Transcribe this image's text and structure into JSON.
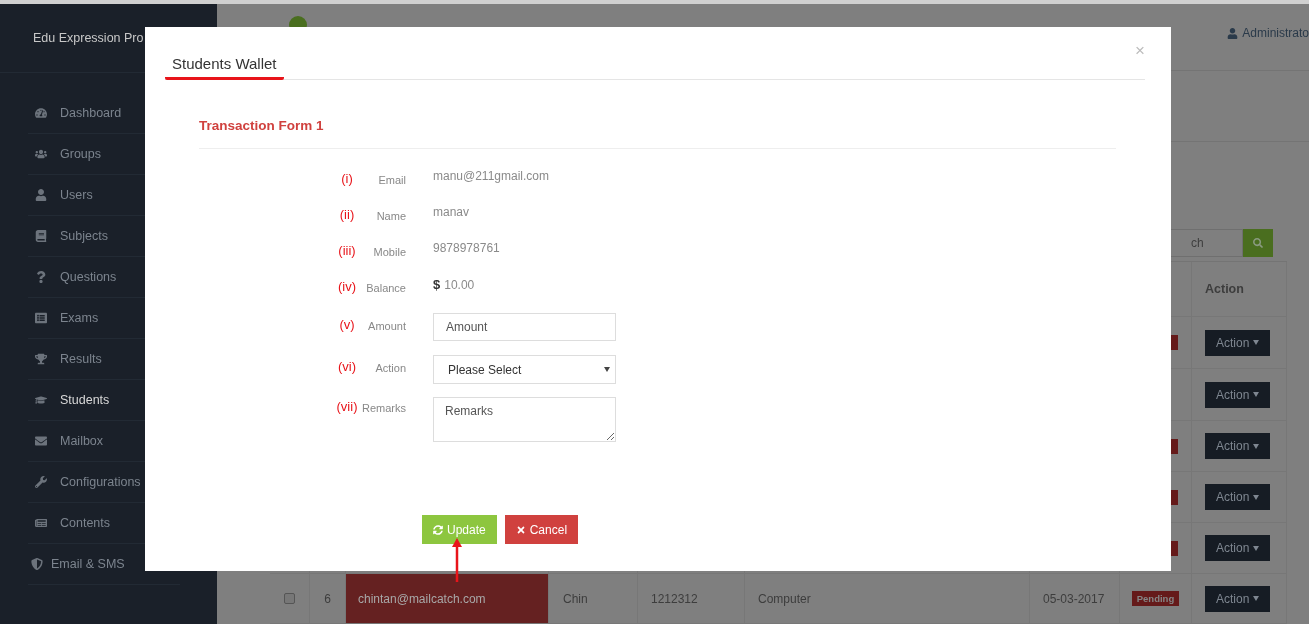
{
  "sidebar": {
    "brand": "Edu Expression Pro",
    "items": [
      {
        "label": "Dashboard",
        "selected": false
      },
      {
        "label": "Groups",
        "selected": false
      },
      {
        "label": "Users",
        "selected": false
      },
      {
        "label": "Subjects",
        "selected": false
      },
      {
        "label": "Questions",
        "selected": false
      },
      {
        "label": "Exams",
        "selected": false
      },
      {
        "label": "Results",
        "selected": false
      },
      {
        "label": "Students",
        "selected": true
      },
      {
        "label": "Mailbox",
        "selected": false
      },
      {
        "label": "Configurations",
        "selected": false
      },
      {
        "label": "Contents",
        "selected": false
      },
      {
        "label": "Email & SMS",
        "selected": false
      }
    ]
  },
  "topbar": {
    "user": "Administrato"
  },
  "search": {
    "placeholder": "ch"
  },
  "table": {
    "columns": [
      {
        "label": "Action"
      }
    ],
    "rows": [
      {
        "badge": true,
        "action": "Action"
      },
      {
        "badge": false,
        "action": "Action"
      },
      {
        "badge": true,
        "action": "Action"
      },
      {
        "badge": true,
        "action": "Action"
      },
      {
        "badge": true,
        "action": "Action"
      },
      {
        "badge": true,
        "checked": false,
        "number": "6",
        "email": "chintan@mailcatch.com",
        "highlighted": true,
        "name": "Chin",
        "mobile": "1212312",
        "subject": "Computer",
        "date": "05-03-2017",
        "status": "Pending",
        "action": "Action"
      }
    ]
  },
  "modal": {
    "title": "Students Wallet",
    "close": "×",
    "section_title": "Transaction Form 1",
    "fields": [
      {
        "marker": "(i)",
        "label": "Email",
        "kind": "text",
        "value": "manu@211gmail.com"
      },
      {
        "marker": "(ii)",
        "label": "Name",
        "kind": "text",
        "value": "manav"
      },
      {
        "marker": "(iii)",
        "label": "Mobile",
        "kind": "text",
        "value": "9878978761"
      },
      {
        "marker": "(iv)",
        "label": "Balance",
        "kind": "currency",
        "currency": "$",
        "value": "10.00"
      },
      {
        "marker": "(v)",
        "label": "Amount",
        "kind": "input",
        "placeholder": "Amount"
      },
      {
        "marker": "(vi)",
        "label": "Action",
        "kind": "select",
        "value": "Please Select"
      },
      {
        "marker": "(vii)",
        "label": "Remarks",
        "kind": "textarea",
        "placeholder": "Remarks"
      }
    ],
    "buttons": [
      {
        "label": "Update",
        "kind": "update"
      },
      {
        "label": "Cancel",
        "kind": "cancel"
      }
    ]
  }
}
